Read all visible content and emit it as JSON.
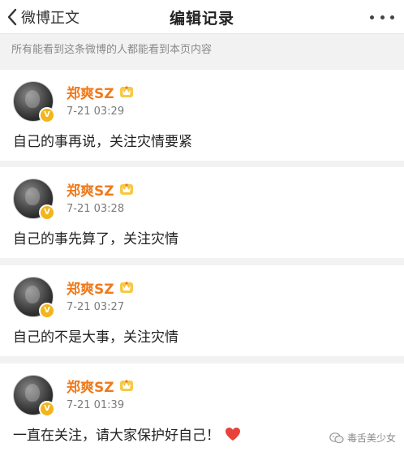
{
  "header": {
    "back_label": "微博正文",
    "title": "编辑记录"
  },
  "notice": "所有能看到这条微博的人都能看到本页内容",
  "records": [
    {
      "username": "郑爽SZ",
      "timestamp": "7-21 03:29",
      "content": "自己的事再说，关注灾情要紧"
    },
    {
      "username": "郑爽SZ",
      "timestamp": "7-21 03:28",
      "content": "自己的事先算了，关注灾情"
    },
    {
      "username": "郑爽SZ",
      "timestamp": "7-21 03:27",
      "content": "自己的不是大事，关注灾情"
    },
    {
      "username": "郑爽SZ",
      "timestamp": "7-21 01:39",
      "content": "一直在关注，请大家保护好自己！"
    }
  ],
  "watermark": "毒舌美少女",
  "colors": {
    "username": "#f07a1a",
    "verified_badge": "#f2b51c",
    "heart": "#e8423b"
  },
  "icons": {
    "back": "chevron-left-icon",
    "more": "more-dots-icon",
    "verified": "verified-v-icon",
    "member": "member-crown-icon",
    "heart": "heart-icon"
  }
}
